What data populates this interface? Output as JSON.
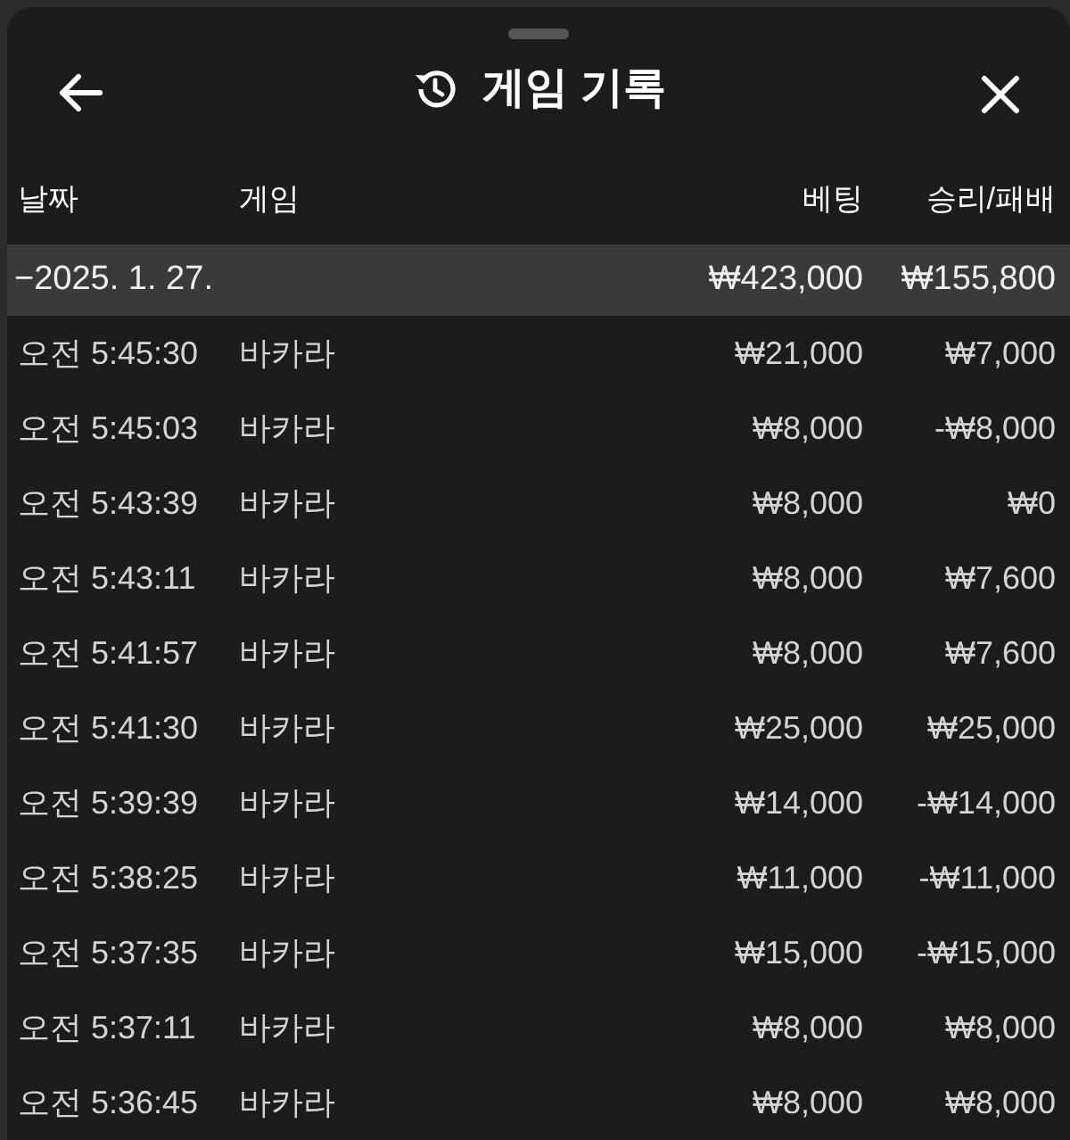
{
  "header": {
    "title": "게임 기록"
  },
  "columns": [
    "날짜",
    "게임",
    "베팅",
    "승리/패배"
  ],
  "group": {
    "toggle": "−",
    "date": "2025. 1. 27.",
    "bet": "₩423,000",
    "result": "₩155,800",
    "expanded": true
  },
  "rows": [
    {
      "time": "오전 5:45:30",
      "game": "바카라",
      "bet": "₩21,000",
      "result": "₩7,000"
    },
    {
      "time": "오전 5:45:03",
      "game": "바카라",
      "bet": "₩8,000",
      "result": "-₩8,000"
    },
    {
      "time": "오전 5:43:39",
      "game": "바카라",
      "bet": "₩8,000",
      "result": "₩0"
    },
    {
      "time": "오전 5:43:11",
      "game": "바카라",
      "bet": "₩8,000",
      "result": "₩7,600"
    },
    {
      "time": "오전 5:41:57",
      "game": "바카라",
      "bet": "₩8,000",
      "result": "₩7,600"
    },
    {
      "time": "오전 5:41:30",
      "game": "바카라",
      "bet": "₩25,000",
      "result": "₩25,000"
    },
    {
      "time": "오전 5:39:39",
      "game": "바카라",
      "bet": "₩14,000",
      "result": "-₩14,000"
    },
    {
      "time": "오전 5:38:25",
      "game": "바카라",
      "bet": "₩11,000",
      "result": "-₩11,000"
    },
    {
      "time": "오전 5:37:35",
      "game": "바카라",
      "bet": "₩15,000",
      "result": "-₩15,000"
    },
    {
      "time": "오전 5:37:11",
      "game": "바카라",
      "bet": "₩8,000",
      "result": "₩8,000"
    },
    {
      "time": "오전 5:36:45",
      "game": "바카라",
      "bet": "₩8,000",
      "result": "₩8,000"
    }
  ]
}
